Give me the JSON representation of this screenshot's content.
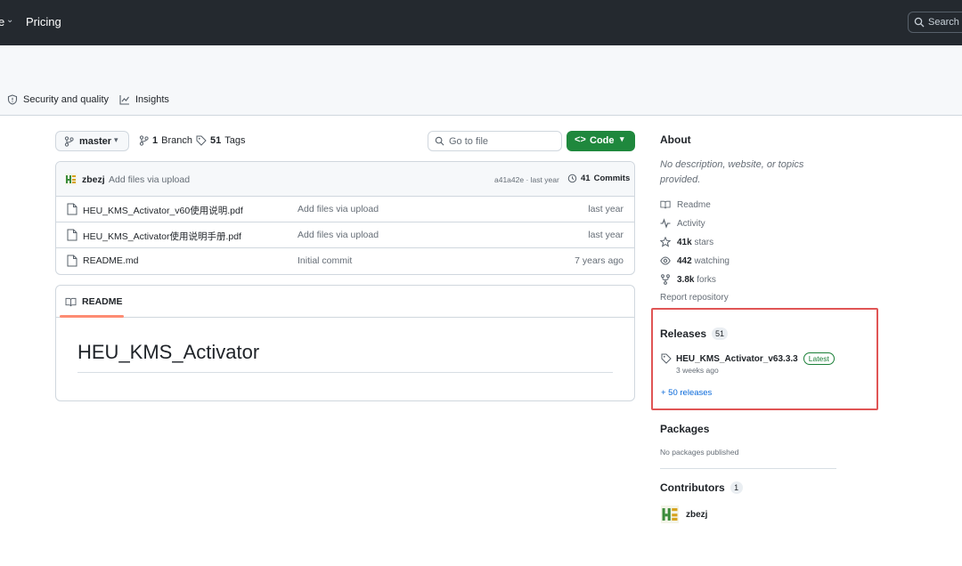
{
  "topbar": {
    "partial_item": "e",
    "pricing": "Pricing",
    "search_placeholder": "Search o"
  },
  "repo_tabs": {
    "security": "Security and quality",
    "insights": "Insights"
  },
  "controls": {
    "branch": "master",
    "branches_count": "1",
    "branches_label": "Branch",
    "tags_count": "51",
    "tags_label": "Tags",
    "go_to_file_placeholder": "Go to file",
    "code_label": "Code"
  },
  "commit": {
    "author": "zbezj",
    "message": "Add files via upload",
    "hash_time": "a41a42e · last year",
    "commits_count": "41",
    "commits_label": "Commits"
  },
  "files": [
    {
      "name": "HEU_KMS_Activator_v60使用说明.pdf",
      "message": "Add files via upload",
      "date": "last year"
    },
    {
      "name": "HEU_KMS_Activator使用说明手册.pdf",
      "message": "Add files via upload",
      "date": "last year"
    },
    {
      "name": "README.md",
      "message": "Initial commit",
      "date": "7 years ago"
    }
  ],
  "readme": {
    "tab_label": "README",
    "heading": "HEU_KMS_Activator"
  },
  "about": {
    "title": "About",
    "description": "No description, website, or topics provided.",
    "readme": "Readme",
    "activity": "Activity",
    "stars_count": "41k",
    "stars_label": "stars",
    "watching_count": "442",
    "watching_label": "watching",
    "forks_count": "3.8k",
    "forks_label": "forks",
    "report": "Report repository"
  },
  "releases": {
    "title": "Releases",
    "count": "51",
    "latest_name": "HEU_KMS_Activator_v63.3.3",
    "latest_badge": "Latest",
    "latest_time": "3 weeks ago",
    "more": "+ 50 releases"
  },
  "packages": {
    "title": "Packages",
    "none": "No packages published"
  },
  "contributors": {
    "title": "Contributors",
    "count": "1",
    "user": "zbezj"
  },
  "colors": {
    "topbar": "#24292f",
    "code_button": "#1f883d",
    "highlight": "#e05555",
    "link": "#0969da"
  }
}
